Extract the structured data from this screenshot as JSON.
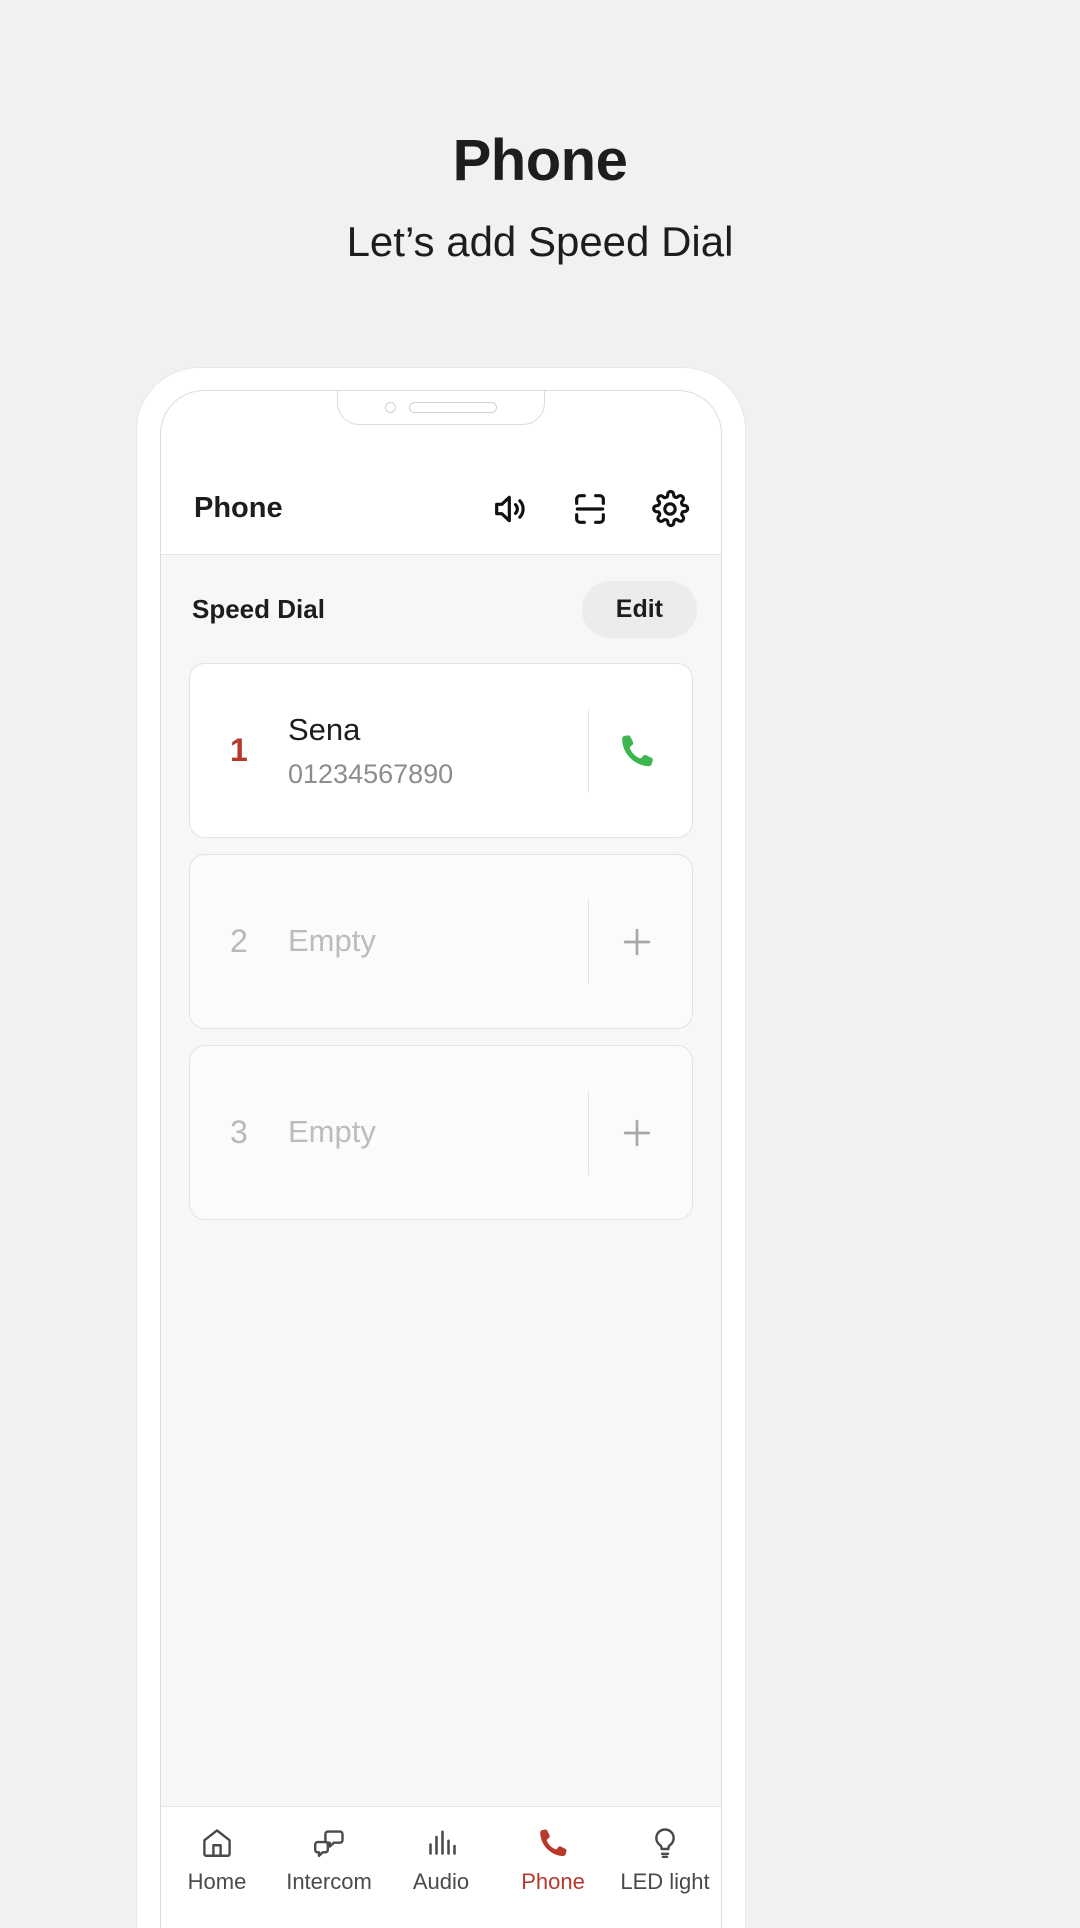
{
  "page": {
    "title": "Phone",
    "subtitle": "Let’s add Speed Dial",
    "background_color": "#f1f1f1"
  },
  "colors": {
    "accent_red": "#b8392c",
    "call_green": "#3cb64f",
    "text_primary": "#1d1d1d",
    "text_muted": "#8d8d8d",
    "text_disabled": "#bcbcbc",
    "card_border": "#e3e3e3",
    "section_bg": "#f7f7f7"
  },
  "app_header": {
    "title": "Phone",
    "actions": [
      {
        "name": "speaker-icon",
        "label": "Speaker"
      },
      {
        "name": "scan-icon",
        "label": "Scan"
      },
      {
        "name": "gear-icon",
        "label": "Settings"
      }
    ]
  },
  "speed_dial": {
    "section_title": "Speed Dial",
    "edit_label": "Edit",
    "entries": [
      {
        "index": "1",
        "name": "Sena",
        "number": "01234567890",
        "empty": false,
        "action_icon": "call-icon"
      },
      {
        "index": "2",
        "name": "Empty",
        "number": "",
        "empty": true,
        "action_icon": "plus-icon"
      },
      {
        "index": "3",
        "name": "Empty",
        "number": "",
        "empty": true,
        "action_icon": "plus-icon"
      }
    ]
  },
  "bottom_nav": {
    "active": "Phone",
    "items": [
      {
        "label": "Home",
        "icon": "home-icon"
      },
      {
        "label": "Intercom",
        "icon": "intercom-icon"
      },
      {
        "label": "Audio",
        "icon": "audio-icon"
      },
      {
        "label": "Phone",
        "icon": "phone-icon"
      },
      {
        "label": "LED light",
        "icon": "bulb-icon"
      }
    ]
  }
}
